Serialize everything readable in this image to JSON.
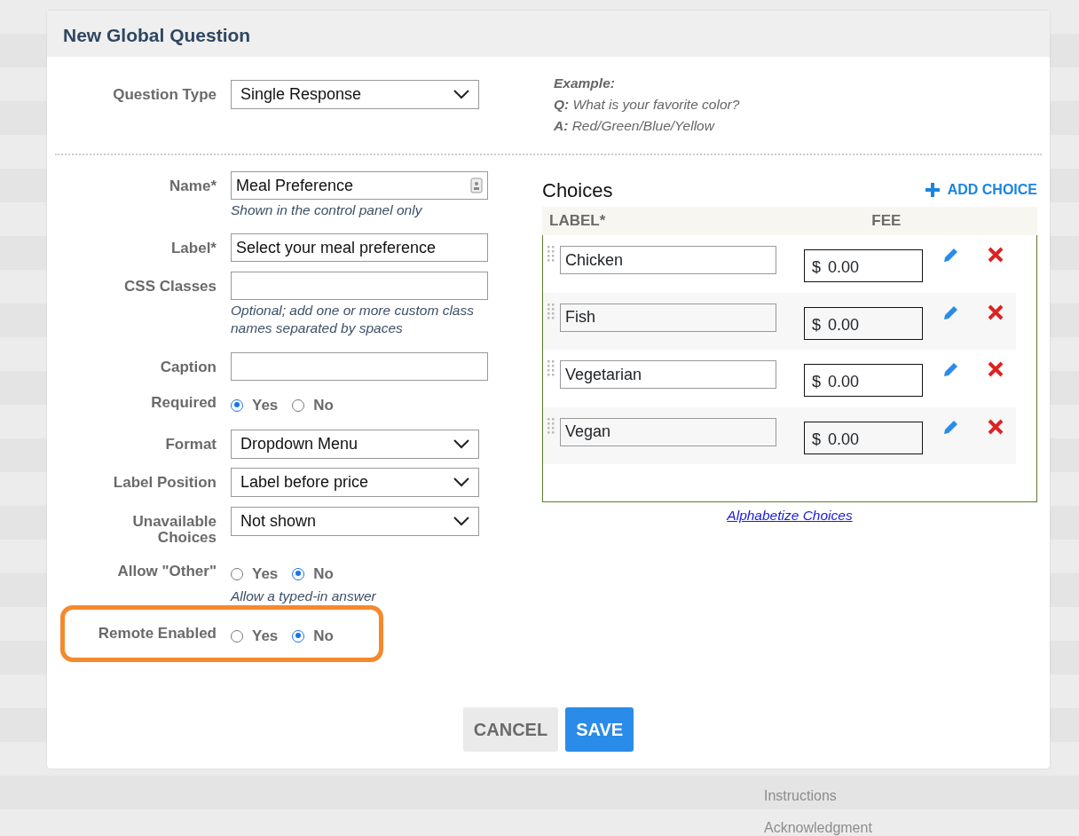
{
  "background_list": [
    {
      "label": "Instructions"
    },
    {
      "label": "Acknowledgment"
    }
  ],
  "dialog": {
    "title": "New Global Question",
    "question_type": {
      "label": "Question Type",
      "value": "Single Response"
    },
    "example": {
      "heading": "Example:",
      "lines": [
        "**Q:** What is your favorite color?",
        "**A:** Red/Green/Blue/Yellow"
      ]
    },
    "fields": [
      {
        "kind": "text",
        "label": "Name*",
        "value": "Meal Preference",
        "hint": "Shown in the control panel only",
        "contact_icon": true
      },
      {
        "kind": "text",
        "label": "Label*",
        "value": "Select your meal preference"
      },
      {
        "kind": "text",
        "label": "CSS Classes",
        "hint": "Optional; add one or more custom class names separated by spaces"
      },
      {
        "kind": "text",
        "label": "Caption"
      },
      {
        "kind": "radio",
        "label": "Required",
        "options": [
          {
            "label": "Yes",
            "selected": true
          },
          {
            "label": "No",
            "selected": false
          }
        ]
      },
      {
        "kind": "select",
        "label": "Format",
        "value": "Dropdown Menu"
      },
      {
        "kind": "select",
        "label": "Label Position",
        "value": "Label before price"
      },
      {
        "kind": "select",
        "label": "Unavailable Choices",
        "value": "Not shown"
      },
      {
        "kind": "radio",
        "label": "Allow \"Other\"",
        "options": [
          {
            "label": "Yes",
            "selected": false
          },
          {
            "label": "No",
            "selected": true
          }
        ],
        "hint": "Allow a typed-in answer"
      },
      {
        "kind": "radio",
        "label": "Remote Enabled",
        "highlighted": true,
        "options": [
          {
            "label": "Yes",
            "selected": false
          },
          {
            "label": "No",
            "selected": true
          }
        ]
      }
    ],
    "choices": {
      "title": "Choices",
      "add_label": "ADD CHOICE",
      "columns": [
        "LABEL*",
        "FEE"
      ],
      "rows": [
        {
          "label": "Chicken",
          "currency": "$",
          "fee": "0.00"
        },
        {
          "label": "Fish",
          "currency": "$",
          "fee": "0.00"
        },
        {
          "label": "Vegetarian",
          "currency": "$",
          "fee": "0.00"
        },
        {
          "label": "Vegan",
          "currency": "$",
          "fee": "0.00"
        }
      ],
      "alphabetize": "Alphabetize Choices"
    },
    "buttons": [
      {
        "kind": "secondary",
        "label": "CANCEL"
      },
      {
        "kind": "primary",
        "label": "SAVE"
      }
    ]
  }
}
